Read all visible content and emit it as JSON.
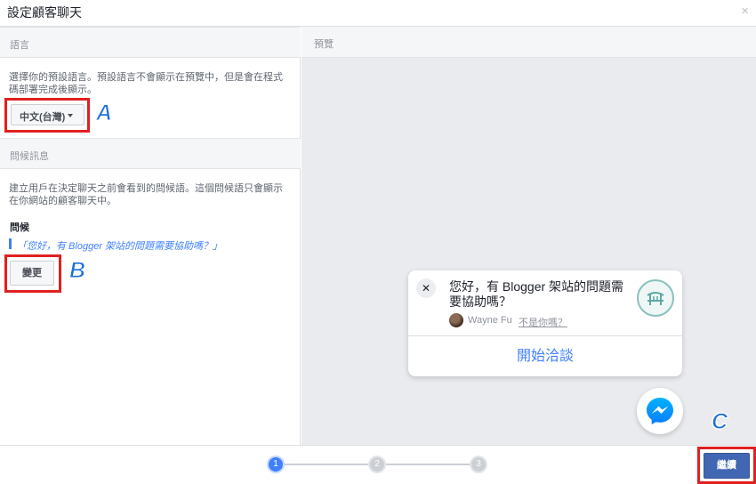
{
  "dialog": {
    "title": "設定顧客聊天",
    "close_glyph": "×"
  },
  "language_section": {
    "header": "語言",
    "description": "選擇你的預設語言。預設語言不會顯示在預覽中，但是會在程式碼部署完成後顯示。",
    "selected_language": "中文(台灣)",
    "annotation": "A"
  },
  "greeting_section": {
    "header": "問候訊息",
    "description": "建立用戶在決定聊天之前會看到的問候語。這個問候語只會顯示在你網站的顧客聊天中。",
    "label": "問候",
    "greeting_text": "「您好，有 Blogger 架站的問題需要協助嗎？」",
    "change_button": "變更",
    "annotation": "B"
  },
  "preview": {
    "header": "預覽",
    "close_glyph": "✕",
    "message": "您好，有 Blogger 架站的問題需要協助嗎？",
    "user_name": "Wayne Fu",
    "not_you": "不是你嗎？",
    "start_chat": "開始洽談"
  },
  "footer": {
    "steps": [
      "1",
      "2",
      "3"
    ],
    "active_step": 1,
    "continue_button": "繼續",
    "annotation": "C"
  },
  "colors": {
    "accent_blue": "#4080ff",
    "primary_button": "#4267b2",
    "highlight_red": "#e02020",
    "annotation_blue": "#1e6fd9"
  }
}
